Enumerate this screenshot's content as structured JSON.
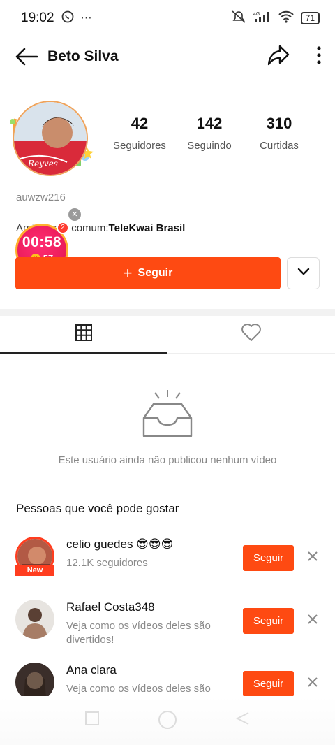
{
  "status_bar": {
    "time": "19:02",
    "battery": "71",
    "network": "4G"
  },
  "header": {
    "name": "Beto Silva"
  },
  "profile": {
    "avatar_caption": "Reyves",
    "username": "auwzw216",
    "stats": [
      {
        "value": "42",
        "label": "Seguidores"
      },
      {
        "value": "142",
        "label": "Seguindo"
      },
      {
        "value": "310",
        "label": "Curtidas"
      }
    ],
    "mutual_prefix": "Amigos em comum:",
    "mutual_name": "TeleKwai Brasil",
    "follow_label": "Seguir"
  },
  "timer": {
    "time": "00:58",
    "coins": "57",
    "notif": "2"
  },
  "empty_state": {
    "text": "Este usuário ainda não publicou nenhum vídeo"
  },
  "suggestions": {
    "title": "Pessoas que você pode gostar",
    "follow_label": "Seguir",
    "items": [
      {
        "name": "celio guedes 😎😎😎",
        "sub": "12.1K seguidores",
        "badge": "New"
      },
      {
        "name": "Rafael Costa348",
        "sub": "Veja como os vídeos deles são divertidos!"
      },
      {
        "name": "Ana clara",
        "sub": "Veja como os vídeos deles são"
      }
    ]
  },
  "colors": {
    "accent": "#fe4a12",
    "timer": "#e0144f"
  }
}
